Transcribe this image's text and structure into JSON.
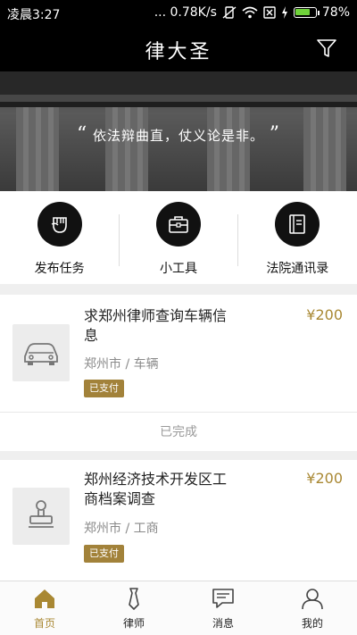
{
  "status_bar": {
    "time": "凌晨3:27",
    "network_speed": "... 0.78K/s",
    "battery_percent": "78%",
    "battery_level": 0.78
  },
  "header": {
    "title": "律大圣"
  },
  "banner": {
    "slogan": "依法辩曲直，仗义论是非。"
  },
  "actions": [
    {
      "label": "发布任务",
      "icon": "fist-icon"
    },
    {
      "label": "小工具",
      "icon": "toolbox-icon"
    },
    {
      "label": "法院通讯录",
      "icon": "address-book-icon"
    }
  ],
  "tasks": [
    {
      "title_line1": "求郑州律师查询车辆信",
      "title_line2": "息",
      "price": "¥200",
      "location": "郑州市 / 车辆",
      "badge": "已支付",
      "status": "已完成",
      "icon": "car-icon"
    },
    {
      "title_line1": "郑州经济技术开发区工",
      "title_line2": "商档案调查",
      "price": "¥200",
      "location": "郑州市 / 工商",
      "badge": "已支付",
      "icon": "stamp-icon"
    }
  ],
  "tabbar": [
    {
      "label": "首页",
      "icon": "home-icon",
      "active": true
    },
    {
      "label": "律师",
      "icon": "tie-icon",
      "active": false
    },
    {
      "label": "消息",
      "icon": "message-icon",
      "active": false
    },
    {
      "label": "我的",
      "icon": "user-icon",
      "active": false
    }
  ],
  "colors": {
    "accent": "#a98833",
    "badge": "#a2823a",
    "header": "#000000"
  }
}
